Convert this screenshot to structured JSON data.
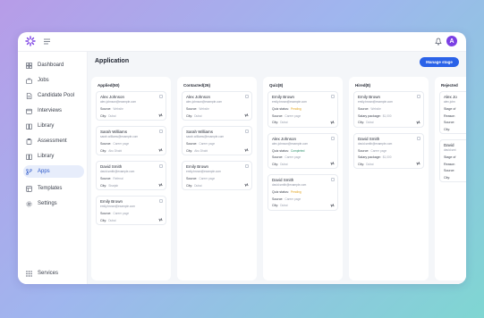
{
  "avatar_initial": "A",
  "sidebar": {
    "items": [
      {
        "label": "Dashboard",
        "icon": "dashboard-icon"
      },
      {
        "label": "Jobs",
        "icon": "briefcase-icon"
      },
      {
        "label": "Candidate Pool",
        "icon": "document-icon"
      },
      {
        "label": "Interviews",
        "icon": "calendar-icon"
      },
      {
        "label": "Library",
        "icon": "book-icon"
      },
      {
        "label": "Assessment",
        "icon": "clipboard-icon"
      },
      {
        "label": "Library",
        "icon": "book-icon"
      },
      {
        "label": "Apps",
        "icon": "branch-icon",
        "active": true
      },
      {
        "label": "Templates",
        "icon": "template-icon"
      },
      {
        "label": "Settings",
        "icon": "gear-icon"
      }
    ],
    "services_label": "Services"
  },
  "main": {
    "title": "Application",
    "manage_button": "Manage stage",
    "columns": [
      {
        "title": "Applied(50)",
        "cards": [
          {
            "name": "Alex Johnson",
            "email": "alex.johnson@example.com",
            "lines": [
              [
                "Source:",
                "Website",
                ""
              ],
              [
                "City:",
                "Dubai",
                ""
              ]
            ]
          },
          {
            "name": "Sarah Williams",
            "email": "sarah.williams@example.com",
            "lines": [
              [
                "Source:",
                "Career page",
                ""
              ],
              [
                "City:",
                "Abu Dhabi",
                ""
              ]
            ]
          },
          {
            "name": "David Smith",
            "email": "david.smith@example.com",
            "lines": [
              [
                "Source:",
                "Referral",
                ""
              ],
              [
                "City:",
                "Sharjah",
                ""
              ]
            ]
          },
          {
            "name": "Emily Brown",
            "email": "emily.brown@example.com",
            "lines": [
              [
                "Source:",
                "Career page",
                ""
              ],
              [
                "City:",
                "Dubai",
                ""
              ]
            ]
          }
        ]
      },
      {
        "title": "Contacted(26)",
        "cards": [
          {
            "name": "Alex Johnson",
            "email": "alex.johnson@example.com",
            "lines": [
              [
                "Source:",
                "Website",
                ""
              ],
              [
                "City:",
                "Dubai",
                ""
              ]
            ]
          },
          {
            "name": "Sarah Williams",
            "email": "sarah.williams@example.com",
            "lines": [
              [
                "Source:",
                "Career page",
                ""
              ],
              [
                "City:",
                "Abu Dhabi",
                ""
              ]
            ]
          },
          {
            "name": "Emily Brown",
            "email": "emily.brown@example.com",
            "lines": [
              [
                "Source:",
                "Career page",
                ""
              ],
              [
                "City:",
                "Dubai",
                ""
              ]
            ]
          }
        ]
      },
      {
        "title": "Quiz(8)",
        "cards": [
          {
            "name": "Emily Brown",
            "email": "emily.brown@example.com",
            "lines": [
              [
                "Quiz status:",
                "Pending",
                "warn"
              ],
              [
                "Source:",
                "Career page",
                ""
              ],
              [
                "City:",
                "Dubai",
                ""
              ]
            ]
          },
          {
            "name": "Alex Johnson",
            "email": "alex.johnson@example.com",
            "lines": [
              [
                "Quiz status:",
                "Completed",
                "ok"
              ],
              [
                "Source:",
                "Career page",
                ""
              ],
              [
                "City:",
                "Dubai",
                ""
              ]
            ]
          },
          {
            "name": "David Smith",
            "email": "david.smith@example.com",
            "lines": [
              [
                "Quiz status:",
                "Pending",
                "warn"
              ],
              [
                "Source:",
                "Career page",
                ""
              ],
              [
                "City:",
                "Dubai",
                ""
              ]
            ]
          }
        ]
      },
      {
        "title": "Hired(8)",
        "cards": [
          {
            "name": "Emily Brown",
            "email": "emily.brown@example.com",
            "lines": [
              [
                "Source:",
                "Website",
                ""
              ],
              [
                "Salary package:",
                "$1,000",
                ""
              ],
              [
                "City:",
                "Dubai",
                ""
              ]
            ]
          },
          {
            "name": "David Smith",
            "email": "david.smith@example.com",
            "lines": [
              [
                "Source:",
                "Career page",
                ""
              ],
              [
                "Salary package:",
                "$1,000",
                ""
              ],
              [
                "City:",
                "Dubai",
                ""
              ]
            ]
          }
        ]
      },
      {
        "title": "Rejected",
        "cards": [
          {
            "name": "Alex Jo",
            "email": "alex.john",
            "lines": [
              [
                "Stage of",
                "",
                ""
              ],
              [
                "Reason",
                "",
                ""
              ],
              [
                "Source:",
                "",
                ""
              ],
              [
                "City:",
                "",
                ""
              ]
            ]
          },
          {
            "name": "David",
            "email": "david.smi",
            "lines": [
              [
                "Stage of",
                "",
                ""
              ],
              [
                "Reason",
                "",
                ""
              ],
              [
                "Source:",
                "",
                ""
              ],
              [
                "City:",
                "",
                ""
              ]
            ]
          }
        ]
      }
    ]
  }
}
